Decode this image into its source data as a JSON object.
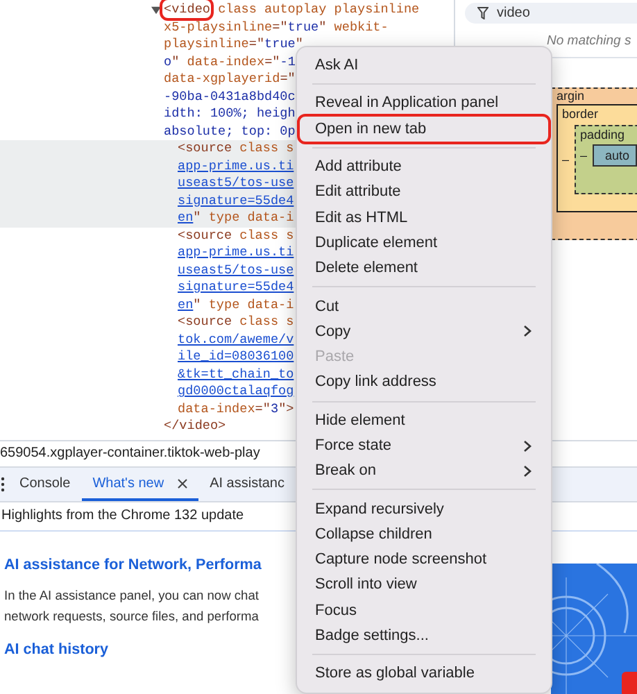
{
  "elements_panel": {
    "code": {
      "expanded": true,
      "lines": [
        [
          {
            "kind": "tag",
            "text": "<video",
            "outlined": true
          },
          {
            "kind": "attr",
            "text": " class autoplay playsinline"
          }
        ],
        [
          {
            "kind": "attr",
            "text": "x5-playsinline"
          },
          {
            "kind": "punct",
            "text": "=\""
          },
          {
            "kind": "value",
            "text": "true"
          },
          {
            "kind": "punct",
            "text": "\" "
          },
          {
            "kind": "attr",
            "text": "webkit-"
          }
        ],
        [
          {
            "kind": "attr",
            "text": "playsinline"
          },
          {
            "kind": "punct",
            "text": "=\""
          },
          {
            "kind": "value",
            "text": "true"
          },
          {
            "kind": "punct",
            "text": "\""
          }
        ],
        [
          {
            "kind": "value",
            "text": "o"
          },
          {
            "kind": "punct",
            "text": "\" "
          },
          {
            "kind": "attr",
            "text": "data-index"
          },
          {
            "kind": "punct",
            "text": "=\""
          },
          {
            "kind": "value",
            "text": "-1"
          }
        ],
        [
          {
            "kind": "attr",
            "text": "data-xgplayerid"
          },
          {
            "kind": "punct",
            "text": "=\""
          }
        ],
        [
          {
            "kind": "value",
            "text": "-90ba-0431a8bd40c"
          }
        ],
        [
          {
            "kind": "value",
            "text": "idth: 100%; heigh"
          }
        ],
        [
          {
            "kind": "value",
            "text": "absolute; top: 0p"
          }
        ]
      ],
      "children": [
        {
          "highlighted": true,
          "lines": [
            [
              {
                "kind": "tag",
                "text": "<source"
              },
              {
                "kind": "attr",
                "text": " class s"
              }
            ],
            [
              {
                "kind": "link",
                "text": "app-prime.us.ti"
              }
            ],
            [
              {
                "kind": "link",
                "text": "useast5/tos-use"
              }
            ],
            [
              {
                "kind": "link",
                "text": "signature=55de4"
              }
            ],
            [
              {
                "kind": "link",
                "text": "en"
              },
              {
                "kind": "punct",
                "text": "\" "
              },
              {
                "kind": "attr",
                "text": "type data-i"
              }
            ]
          ]
        },
        {
          "highlighted": false,
          "lines": [
            [
              {
                "kind": "tag",
                "text": "<source"
              },
              {
                "kind": "attr",
                "text": " class s"
              }
            ],
            [
              {
                "kind": "link",
                "text": "app-prime.us.ti"
              }
            ],
            [
              {
                "kind": "link",
                "text": "useast5/tos-use"
              }
            ],
            [
              {
                "kind": "link",
                "text": "signature=55de4"
              }
            ],
            [
              {
                "kind": "link",
                "text": "en"
              },
              {
                "kind": "punct",
                "text": "\" "
              },
              {
                "kind": "attr",
                "text": "type data-i"
              }
            ]
          ]
        },
        {
          "highlighted": false,
          "lines": [
            [
              {
                "kind": "tag",
                "text": "<source"
              },
              {
                "kind": "attr",
                "text": " class s"
              }
            ],
            [
              {
                "kind": "link",
                "text": "tok.com/aweme/v"
              }
            ],
            [
              {
                "kind": "link",
                "text": "ile_id=08036100"
              }
            ],
            [
              {
                "kind": "link",
                "text": "&tk=tt_chain_to"
              }
            ],
            [
              {
                "kind": "link",
                "text": "gd0000ctalaqfog"
              }
            ],
            [
              {
                "kind": "attr",
                "text": "data-index"
              },
              {
                "kind": "punct",
                "text": "=\""
              },
              {
                "kind": "value",
                "text": "3"
              },
              {
                "kind": "punct",
                "text": "\">"
              }
            ]
          ]
        }
      ],
      "closing": [
        {
          "kind": "tag",
          "text": "</video>"
        }
      ]
    }
  },
  "sidebar": {
    "filter": {
      "value": "video"
    },
    "hint": "No matching s",
    "box_model": {
      "margin_label": "argin",
      "border_label": "border",
      "padding_label": "padding",
      "border_left": "–",
      "padding_left": "–",
      "content": "auto"
    }
  },
  "breadcrumb": "659054.xgplayer-container.tiktok-web-play",
  "drawer": {
    "tabs": [
      {
        "label": "Console",
        "selected": false,
        "closable": false
      },
      {
        "label": "What's new",
        "selected": true,
        "closable": true
      },
      {
        "label": "AI assistanc",
        "selected": false,
        "closable": false
      }
    ],
    "subtitle": "Highlights from the Chrome 132 update",
    "sections": [
      {
        "kind": "heading",
        "text": "AI assistance for Network, Performa"
      },
      {
        "kind": "paragraph",
        "lines": [
          "In the AI assistance panel, you can now chat",
          "network requests, source files, and performa"
        ]
      },
      {
        "kind": "heading",
        "text": "AI chat history"
      }
    ]
  },
  "context_menu": {
    "groups": [
      [
        {
          "label": "Ask AI",
          "submenu": false,
          "disabled": false,
          "outlined": false
        }
      ],
      [
        {
          "label": "Reveal in Application panel",
          "submenu": false,
          "disabled": false,
          "outlined": false
        },
        {
          "label": "Open in new tab",
          "submenu": false,
          "disabled": false,
          "outlined": true
        }
      ],
      [
        {
          "label": "Add attribute",
          "submenu": false,
          "disabled": false,
          "outlined": false
        },
        {
          "label": "Edit attribute",
          "submenu": false,
          "disabled": false,
          "outlined": false
        },
        {
          "label": "Edit as HTML",
          "submenu": false,
          "disabled": false,
          "outlined": false
        },
        {
          "label": "Duplicate element",
          "submenu": false,
          "disabled": false,
          "outlined": false
        },
        {
          "label": "Delete element",
          "submenu": false,
          "disabled": false,
          "outlined": false
        }
      ],
      [
        {
          "label": "Cut",
          "submenu": false,
          "disabled": false,
          "outlined": false
        },
        {
          "label": "Copy",
          "submenu": true,
          "disabled": false,
          "outlined": false
        },
        {
          "label": "Paste",
          "submenu": false,
          "disabled": true,
          "outlined": false
        },
        {
          "label": "Copy link address",
          "submenu": false,
          "disabled": false,
          "outlined": false
        }
      ],
      [
        {
          "label": "Hide element",
          "submenu": false,
          "disabled": false,
          "outlined": false
        },
        {
          "label": "Force state",
          "submenu": true,
          "disabled": false,
          "outlined": false
        },
        {
          "label": "Break on",
          "submenu": true,
          "disabled": false,
          "outlined": false
        }
      ],
      [
        {
          "label": "Expand recursively",
          "submenu": false,
          "disabled": false,
          "outlined": false
        },
        {
          "label": "Collapse children",
          "submenu": false,
          "disabled": false,
          "outlined": false
        },
        {
          "label": "Capture node screenshot",
          "submenu": false,
          "disabled": false,
          "outlined": false
        },
        {
          "label": "Scroll into view",
          "submenu": false,
          "disabled": false,
          "outlined": false
        },
        {
          "label": "Focus",
          "submenu": false,
          "disabled": false,
          "outlined": false
        },
        {
          "label": "Badge settings...",
          "submenu": false,
          "disabled": false,
          "outlined": false
        }
      ],
      [
        {
          "label": "Store as global variable",
          "submenu": false,
          "disabled": false,
          "outlined": false
        }
      ]
    ]
  }
}
